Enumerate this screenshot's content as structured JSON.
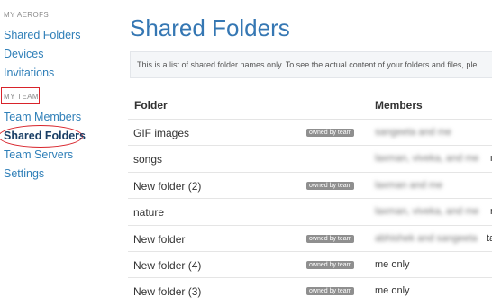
{
  "sidebar": {
    "section1_label": "MY AEROFS",
    "section1_items": [
      "Shared Folders",
      "Devices",
      "Invitations"
    ],
    "section2_label": "MY TEAM",
    "section2_items": [
      "Team Members",
      "Shared Folders",
      "Team Servers",
      "Settings"
    ],
    "active_item": "Shared Folders"
  },
  "main": {
    "title": "Shared Folders",
    "info_text": "This is a list of shared folder names only. To see the actual content of your folders and files, ple",
    "columns": [
      "Folder",
      "Members"
    ],
    "badge_label": "owned by team",
    "rows": [
      {
        "folder": "GIF images",
        "badge": true,
        "members": "sangeeta and me",
        "blurred": true,
        "tail": ""
      },
      {
        "folder": "songs",
        "badge": false,
        "members": "laxman, viveka, and me",
        "blurred": true,
        "tail": "me"
      },
      {
        "folder": "New folder (2)",
        "badge": true,
        "members": "laxman and me",
        "blurred": true,
        "tail": ""
      },
      {
        "folder": "nature",
        "badge": false,
        "members": "laxman, viveka, and me",
        "blurred": true,
        "tail": "me"
      },
      {
        "folder": "New folder",
        "badge": true,
        "members": "abhishek and sangeeta",
        "blurred": true,
        "tail": "ta"
      },
      {
        "folder": "New folder (4)",
        "badge": true,
        "members": "me only",
        "blurred": false,
        "tail": ""
      },
      {
        "folder": "New folder (3)",
        "badge": true,
        "members": "me only",
        "blurred": false,
        "tail": ""
      }
    ]
  },
  "colors": {
    "link": "#2f7fb8",
    "title": "#3577b3",
    "active": "#1a3f66",
    "annotation": "#d8232a",
    "badge": "#8f8f8f"
  }
}
